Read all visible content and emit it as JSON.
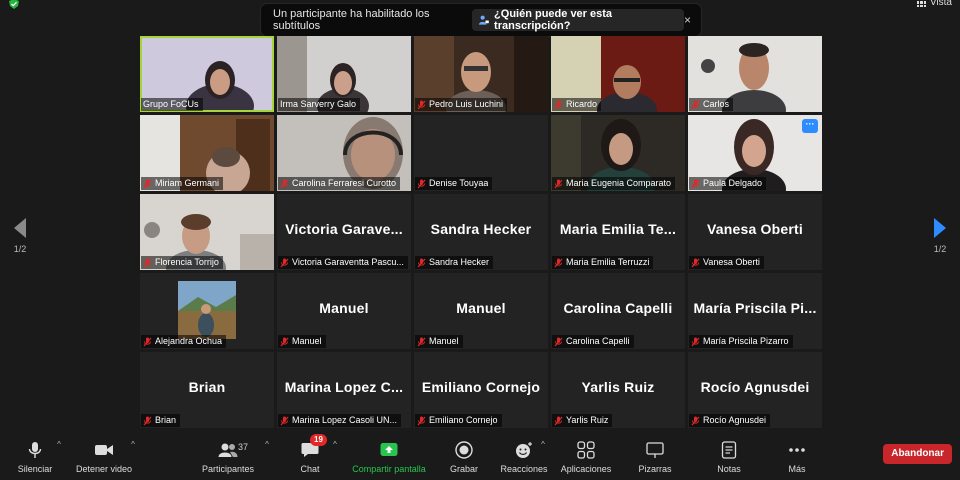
{
  "notice": {
    "message": "Un participante ha habilitado los subtítulos",
    "who_button": "¿Quién puede ver esta transcripción?",
    "close": "×"
  },
  "view_button": "Vista",
  "pager": {
    "left": "1/2",
    "right": "1/2"
  },
  "participants": [
    {
      "label": "Grupo FoCUs",
      "big": ""
    },
    {
      "label": "Irma Sarverry Galo",
      "big": ""
    },
    {
      "label": "Pedro Luis Luchini",
      "big": ""
    },
    {
      "label": "Ricardo",
      "big": ""
    },
    {
      "label": "Carlos",
      "big": ""
    },
    {
      "label": "Miriam Germani",
      "big": ""
    },
    {
      "label": "Carolina Ferraresi Curotto",
      "big": ""
    },
    {
      "label": "Denise Touyaa",
      "big": ""
    },
    {
      "label": "Maria Eugenia Comparato",
      "big": ""
    },
    {
      "label": "Paula Delgado",
      "big": ""
    },
    {
      "label": "Florencia Torrijo",
      "big": ""
    },
    {
      "label": "Victoria Garaventta Pascu...",
      "big": "Victoria Garave..."
    },
    {
      "label": "Sandra Hecker",
      "big": "Sandra Hecker"
    },
    {
      "label": "Maria Emilia Terruzzi",
      "big": "Maria Emilia Te..."
    },
    {
      "label": "Vanesa Oberti",
      "big": "Vanesa Oberti"
    },
    {
      "label": "Alejandra Ochua",
      "big": ""
    },
    {
      "label": "Manuel",
      "big": "Manuel"
    },
    {
      "label": "Manuel",
      "big": "Manuel"
    },
    {
      "label": "Carolina Capelli",
      "big": "Carolina Capelli"
    },
    {
      "label": "María Priscila Pizarro",
      "big": "María Priscila Pi..."
    },
    {
      "label": "Brian",
      "big": "Brian"
    },
    {
      "label": "Marina Lopez Casoli UN...",
      "big": "Marina Lopez C..."
    },
    {
      "label": "Emiliano Cornejo",
      "big": "Emiliano Cornejo"
    },
    {
      "label": "Yarlis Ruiz",
      "big": "Yarlis Ruiz"
    },
    {
      "label": "Rocío Agnusdei",
      "big": "Rocío Agnusdei"
    }
  ],
  "more_button": "···",
  "toolbar": {
    "mute": "Silenciar",
    "stop_video": "Detener video",
    "participants": "Participantes",
    "participants_count": "37",
    "chat": "Chat",
    "chat_badge": "19",
    "share_screen": "Compartir pantalla",
    "record": "Grabar",
    "reactions": "Reacciones",
    "apps": "Aplicaciones",
    "whiteboards": "Pizarras",
    "notes": "Notas",
    "more": "Más",
    "leave": "Abandonar"
  },
  "colors": {
    "active_speaker": "#a6d43a",
    "accent_blue": "#2d8cff",
    "share_green": "#29c44f",
    "leave_red": "#c8262a",
    "mute_red": "#e02828"
  }
}
